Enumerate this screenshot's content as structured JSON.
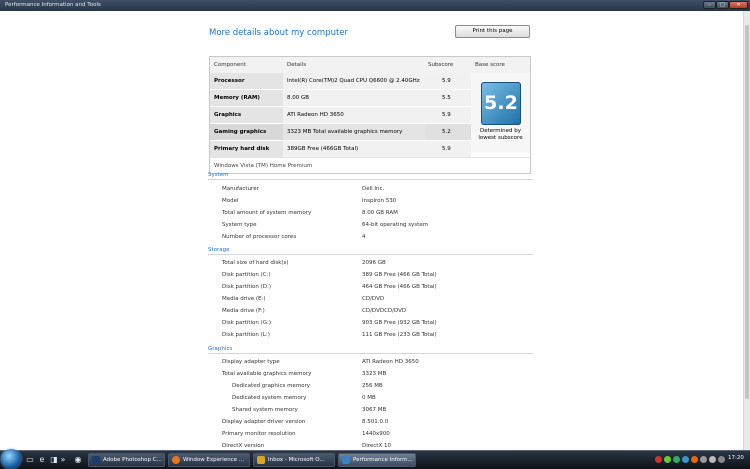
{
  "window": {
    "title": "Performance Information and Tools",
    "min_glyph": "–",
    "max_glyph": "□",
    "close_glyph": "✕"
  },
  "page": {
    "heading": "More details about my computer",
    "print_button": "Print this page"
  },
  "score_table": {
    "headers": {
      "component": "Component",
      "details": "Details",
      "subscore": "Subscore",
      "base_score": "Base score"
    },
    "rows": [
      {
        "component": "Processor",
        "details": "Intel(R) Core(TM)2 Quad CPU Q6600 @ 2.40GHz",
        "subscore": "5.9"
      },
      {
        "component": "Memory (RAM)",
        "details": "8.00 GB",
        "subscore": "5.5"
      },
      {
        "component": "Graphics",
        "details": "ATI Radeon HD 3650",
        "subscore": "5.9"
      },
      {
        "component": "Gaming graphics",
        "details": "3323 MB Total available graphics memory",
        "subscore": "5.2"
      },
      {
        "component": "Primary hard disk",
        "details": "389GB Free (466GB Total)",
        "subscore": "5.9"
      }
    ],
    "base_score": "5.2",
    "base_caption_1": "Determined by",
    "base_caption_2": "lowest subscore",
    "os": "Windows Vista (TM) Home Premium"
  },
  "system": {
    "title": "System",
    "items": [
      {
        "label": "Manufacturer",
        "value": "Dell Inc."
      },
      {
        "label": "Model",
        "value": "Inspiron 530"
      },
      {
        "label": "Total amount of system memory",
        "value": "8.00 GB RAM"
      },
      {
        "label": "System type",
        "value": "64-bit operating system"
      },
      {
        "label": "Number of processor cores",
        "value": "4"
      }
    ]
  },
  "storage": {
    "title": "Storage",
    "items": [
      {
        "label": "Total size of hard disk(s)",
        "value": "2096 GB"
      },
      {
        "label": "Disk partition (C:)",
        "value": "389 GB Free (466 GB Total)"
      },
      {
        "label": "Disk partition (D:)",
        "value": "464 GB Free (466 GB Total)"
      },
      {
        "label": "Media drive (E:)",
        "value": "CD/DVD"
      },
      {
        "label": "Media drive (F:)",
        "value": "CD/DVDCD/DVD"
      },
      {
        "label": "Disk partition (G:)",
        "value": "903 GB Free (932 GB Total)"
      },
      {
        "label": "Disk partition (L:)",
        "value": "111 GB Free (233 GB Total)"
      }
    ]
  },
  "graphics": {
    "title": "Graphics",
    "items": [
      {
        "label": "Display adapter type",
        "value": "ATI Radeon HD 3650"
      },
      {
        "label": "Total available graphics memory",
        "value": "3323 MB"
      },
      {
        "label": "Dedicated graphics memory",
        "value": "256 MB"
      },
      {
        "label": "Dedicated system memory",
        "value": "0 MB"
      },
      {
        "label": "Shared system memory",
        "value": "3067 MB"
      },
      {
        "label": "Display adapter driver version",
        "value": "8.501.0.0"
      },
      {
        "label": "Primary monitor resolution",
        "value": "1440x900"
      },
      {
        "label": "DirectX version",
        "value": "DirectX 10"
      }
    ]
  },
  "taskbar": {
    "quicklaunch_more": "»",
    "tasks": [
      {
        "label": "Adobe Photoshop C...",
        "color": "#1d3c6e"
      },
      {
        "label": "Window Experience ...",
        "color": "#e8751a"
      },
      {
        "label": "Inbox - Microsoft O...",
        "color": "#d9a520"
      },
      {
        "label": "Performance Inform...",
        "color": "#3b82c4"
      }
    ],
    "clock": "17:20"
  }
}
